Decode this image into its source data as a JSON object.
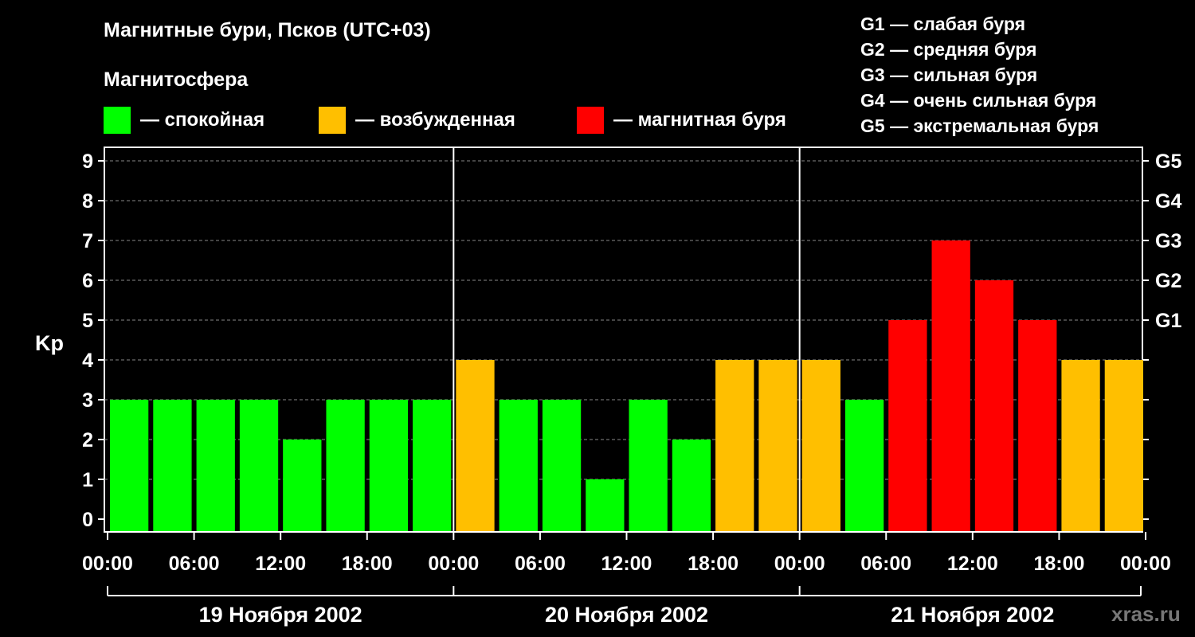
{
  "title": "Магнитные бури, Псков (UTC+03)",
  "subtitle": "Магнитосфера",
  "legend": [
    {
      "label": "— спокойная",
      "color": "#00ff00"
    },
    {
      "label": "— возбужденная",
      "color": "#ffbf00"
    },
    {
      "label": "— магнитная буря",
      "color": "#ff0000"
    }
  ],
  "g_legend": [
    "G1 — слабая буря",
    "G2 — средняя буря",
    "G3 — сильная буря",
    "G4 — очень сильная буря",
    "G5 — экстремальная буря"
  ],
  "watermark": "xras.ru",
  "chart_data": {
    "type": "bar",
    "ylabel": "Kp",
    "ylim": [
      0,
      9
    ],
    "yticks": [
      "0",
      "1",
      "2",
      "3",
      "4",
      "5",
      "6",
      "7",
      "8",
      "9"
    ],
    "right_ticks": [
      {
        "kp": 5,
        "label": "G1"
      },
      {
        "kp": 6,
        "label": "G2"
      },
      {
        "kp": 7,
        "label": "G3"
      },
      {
        "kp": 8,
        "label": "G4"
      },
      {
        "kp": 9,
        "label": "G5"
      }
    ],
    "grid": true,
    "xticks": [
      "00:00",
      "06:00",
      "12:00",
      "18:00",
      "00:00",
      "06:00",
      "12:00",
      "18:00",
      "00:00",
      "06:00",
      "12:00",
      "18:00",
      "00:00"
    ],
    "days": [
      "19 Ноября 2002",
      "20 Ноября 2002",
      "21 Ноября 2002"
    ],
    "interval_hours": 3,
    "values": [
      3,
      3,
      3,
      3,
      2,
      3,
      3,
      3,
      4,
      3,
      3,
      1,
      3,
      2,
      4,
      4,
      4,
      3,
      5,
      7,
      6,
      5,
      4,
      4
    ],
    "colors": {
      "quiet": "#00ff00",
      "active": "#ffbf00",
      "storm": "#ff0000"
    }
  }
}
